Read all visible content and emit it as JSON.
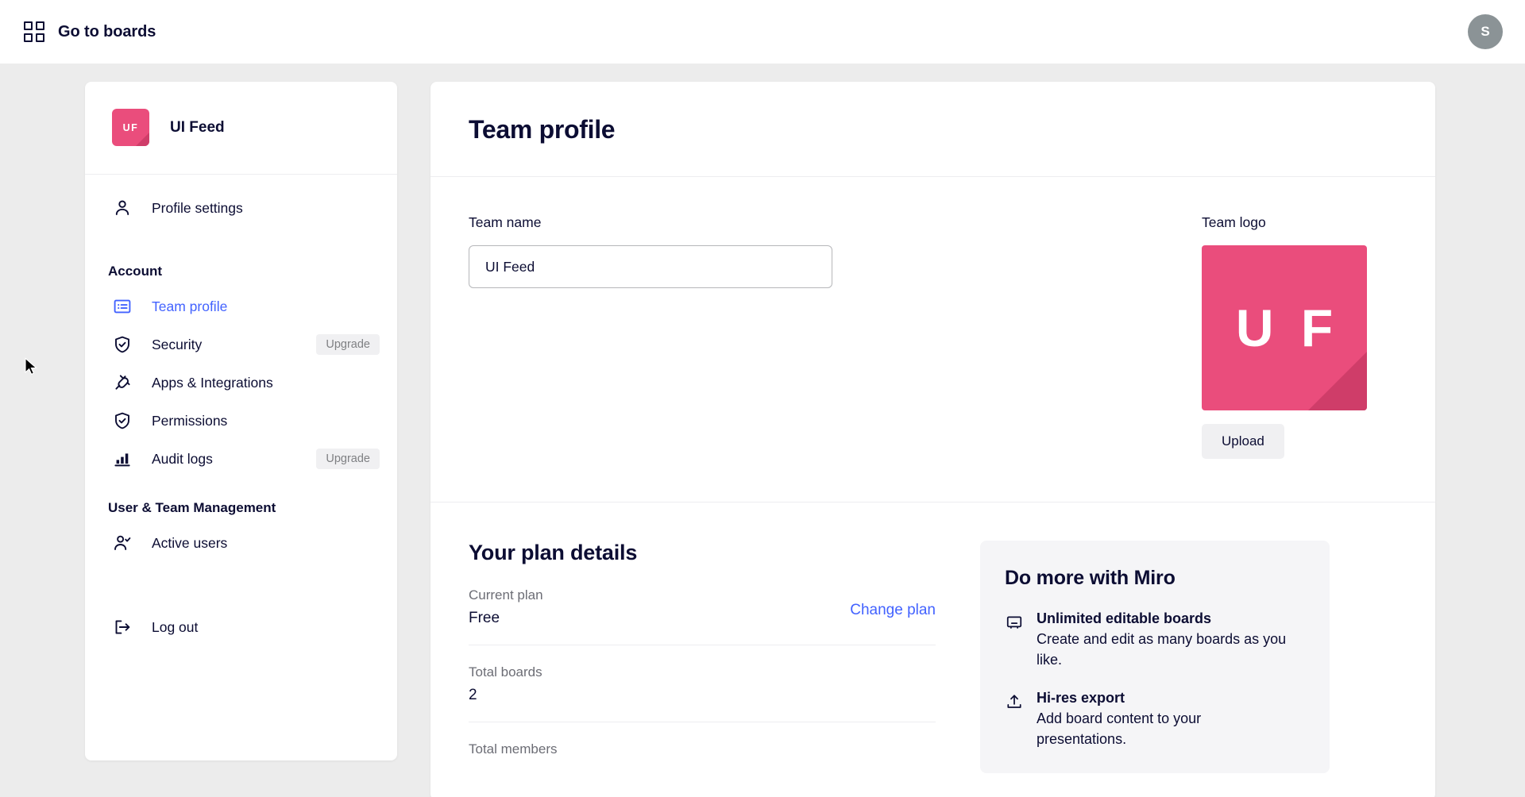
{
  "topbar": {
    "boards_label": "Go to boards",
    "boards_icon": "grid-icon",
    "avatar_initial": "S"
  },
  "sidebar": {
    "team": {
      "logo_initials": "UF",
      "name": "UI Feed",
      "logo_color": "#ea4d7c"
    },
    "top_items": [
      {
        "label": "Profile settings",
        "icon": "user-icon"
      }
    ],
    "groups": [
      {
        "title": "Account",
        "items": [
          {
            "label": "Team profile",
            "icon": "team-profile-icon",
            "active": true,
            "badge": ""
          },
          {
            "label": "Security",
            "icon": "shield-check-icon",
            "active": false,
            "badge": "Upgrade"
          },
          {
            "label": "Apps & Integrations",
            "icon": "plug-icon",
            "active": false,
            "badge": ""
          },
          {
            "label": "Permissions",
            "icon": "shield-check-icon",
            "active": false,
            "badge": ""
          },
          {
            "label": "Audit logs",
            "icon": "bar-chart-icon",
            "active": false,
            "badge": "Upgrade"
          }
        ]
      },
      {
        "title": "User & Team Management",
        "items": [
          {
            "label": "Active users",
            "icon": "user-check-icon",
            "active": false,
            "badge": ""
          }
        ]
      }
    ],
    "logout": {
      "label": "Log out",
      "icon": "logout-icon"
    }
  },
  "main": {
    "title": "Team profile",
    "team_name": {
      "label": "Team name",
      "value": "UI Feed",
      "placeholder": "Team name"
    },
    "team_logo": {
      "label": "Team logo",
      "initials": "U F",
      "upload_label": "Upload"
    },
    "plan": {
      "title": "Your plan details",
      "change_plan_label": "Change plan",
      "rows": [
        {
          "label": "Current plan",
          "value": "Free"
        },
        {
          "label": "Total boards",
          "value": "2"
        },
        {
          "label": "Total members",
          "value": ""
        }
      ]
    },
    "promo": {
      "title": "Do more with Miro",
      "items": [
        {
          "icon": "board-icon",
          "title": "Unlimited editable boards",
          "desc": "Create and edit as many boards as you like."
        },
        {
          "icon": "upload-icon",
          "title": "Hi-res export",
          "desc": "Add board content to your presentations."
        }
      ]
    }
  },
  "colors": {
    "accent": "#4262ff",
    "brand_pink": "#ea4d7c",
    "text": "#0c0d33",
    "muted": "#6c6d75"
  }
}
